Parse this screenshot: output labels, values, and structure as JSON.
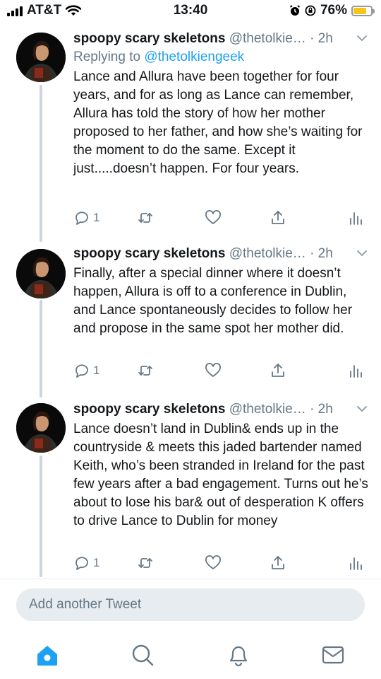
{
  "status_bar": {
    "carrier": "AT&T",
    "time": "13:40",
    "battery": "76%",
    "battery_level": 0.76
  },
  "tweets": [
    {
      "name": "spoopy scary skeletons",
      "handle": "@thetolkie…",
      "separator": "·",
      "time": "2h",
      "reply_prefix": "Replying to",
      "reply_to": "@thetolkiengeek",
      "text": "Lance and Allura have been together for four years, and for as long as Lance can remember, Allura has told the story of how her mother proposed to her father, and how she’s waiting for the moment to do the same. Except it just.....doesn’t happen. For four years.",
      "reply_count": "1"
    },
    {
      "name": "spoopy scary skeletons",
      "handle": "@thetolkie…",
      "separator": "·",
      "time": "2h",
      "text": "Finally, after a special dinner where it doesn’t happen, Allura is off to a conference in Dublin, and Lance spontaneously decides to follow her and propose in the same spot her mother did.",
      "reply_count": "1"
    },
    {
      "name": "spoopy scary skeletons",
      "handle": "@thetolkie…",
      "separator": "·",
      "time": "2h",
      "text": "Lance doesn’t land in Dublin& ends up in the countryside & meets this jaded bartender named Keith, who’s been stranded in Ireland for the past few years after a bad engagement. Turns out he’s about to lose his bar& out of desperation K offers to drive Lance to Dublin for money",
      "reply_count": "1"
    }
  ],
  "compose": {
    "placeholder": "Add another Tweet"
  },
  "tab_bar": {
    "items": [
      "home-icon",
      "search-icon",
      "notifications-icon",
      "messages-icon"
    ]
  },
  "colors": {
    "accent": "#1da1f2",
    "muted": "#657786",
    "thread_line": "#ccd6dd",
    "compose_bg": "#e6ecf0"
  }
}
